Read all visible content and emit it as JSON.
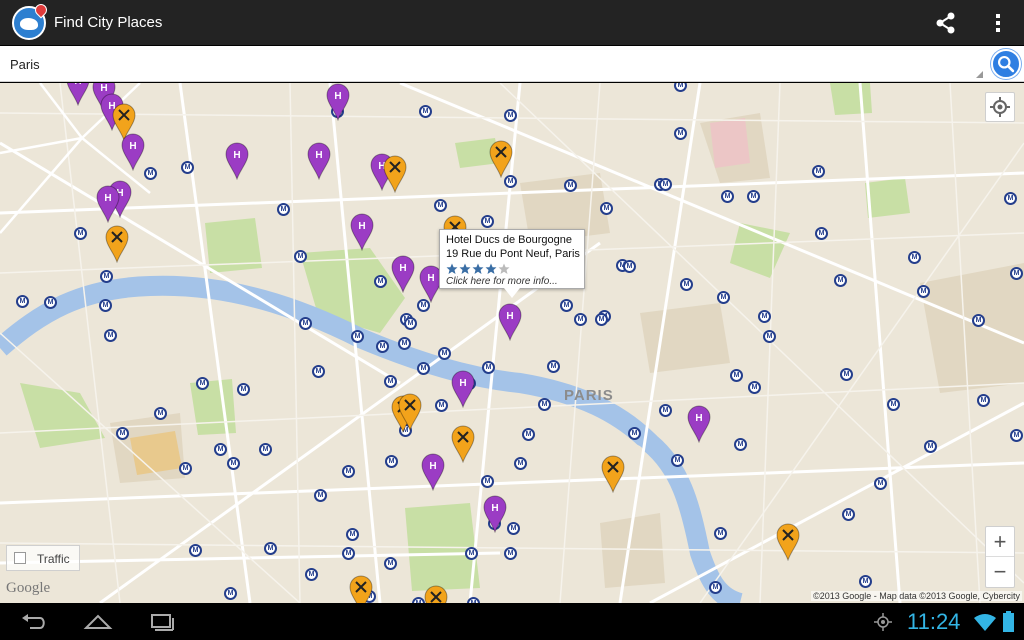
{
  "app": {
    "title": "Find City Places"
  },
  "search": {
    "value": "Paris",
    "placeholder": ""
  },
  "map": {
    "city_label": "PARIS",
    "traffic_label": "Traffic",
    "google_logo": "Google",
    "copyright": "©2013 Google - Map data ©2013 Google, Cybercity",
    "zoom_in_label": "+",
    "zoom_out_label": "−",
    "metro_label": "M",
    "hotel_marker_letter": "H",
    "info_window": {
      "name": "Hotel Ducs de Bourgogne",
      "address": "19 Rue du Pont Neuf, Paris",
      "rating": 4,
      "rating_max": 5,
      "link_text": "Click here for more info..."
    }
  },
  "status": {
    "time": "11:24"
  },
  "colors": {
    "hotel_marker": "#9b3cc4",
    "restaurant_marker": "#f2a31b",
    "river": "#a4c3e8",
    "park": "#c8dfa5",
    "metro": "#243e8c",
    "clock": "#33b5e5"
  }
}
